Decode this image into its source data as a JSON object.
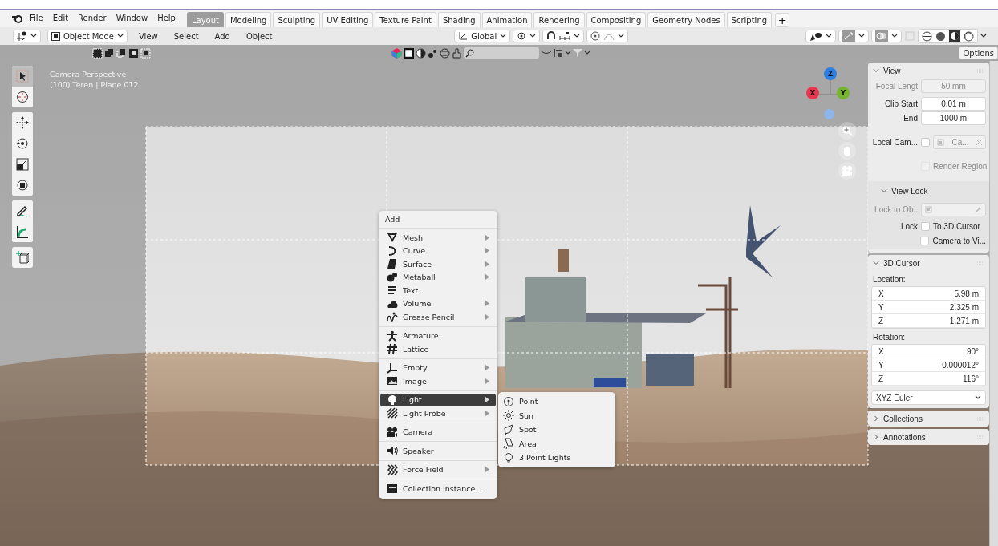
{
  "menubar": {
    "items": [
      "File",
      "Edit",
      "Render",
      "Window",
      "Help"
    ]
  },
  "workspaces": [
    {
      "label": "Layout",
      "selected": true
    },
    {
      "label": "Modeling",
      "selected": false
    },
    {
      "label": "Sculpting",
      "selected": false
    },
    {
      "label": "UV Editing",
      "selected": false
    },
    {
      "label": "Texture Paint",
      "selected": false
    },
    {
      "label": "Shading",
      "selected": false
    },
    {
      "label": "Animation",
      "selected": false
    },
    {
      "label": "Rendering",
      "selected": false
    },
    {
      "label": "Compositing",
      "selected": false
    },
    {
      "label": "Geometry Nodes",
      "selected": false
    },
    {
      "label": "Scripting",
      "selected": false
    }
  ],
  "add_workspace": "+",
  "header": {
    "mode": "Object Mode",
    "menus": [
      "View",
      "Select",
      "Add",
      "Object"
    ],
    "orientation": "Global"
  },
  "viewport": {
    "tool_options": "Options",
    "overlay_lines": [
      "Camera Perspective",
      "(100) Teren | Plane.012"
    ],
    "gizmo_axes": [
      {
        "label": "Z",
        "color": "#2f7fe0"
      },
      {
        "label": "X",
        "color": "#e8364f"
      },
      {
        "label": "Y",
        "color": "#78b52f"
      }
    ]
  },
  "add_menu": {
    "title": "Add",
    "groups": [
      [
        {
          "label": "Mesh",
          "kind": "mesh",
          "submenu": true,
          "selected": false
        },
        {
          "label": "Curve",
          "kind": "curve",
          "submenu": true,
          "selected": false
        },
        {
          "label": "Surface",
          "kind": "surface",
          "submenu": true,
          "selected": false
        },
        {
          "label": "Metaball",
          "kind": "metaball",
          "submenu": true,
          "selected": false
        },
        {
          "label": "Text",
          "kind": "text",
          "submenu": false,
          "selected": false
        },
        {
          "label": "Volume",
          "kind": "volume",
          "submenu": true,
          "selected": false
        },
        {
          "label": "Grease Pencil",
          "kind": "pencil",
          "submenu": true,
          "selected": false
        }
      ],
      [
        {
          "label": "Armature",
          "kind": "armature",
          "submenu": false,
          "selected": false
        },
        {
          "label": "Lattice",
          "kind": "lattice",
          "submenu": false,
          "selected": false
        }
      ],
      [
        {
          "label": "Empty",
          "kind": "empty",
          "submenu": true,
          "selected": false
        },
        {
          "label": "Image",
          "kind": "image",
          "submenu": true,
          "selected": false
        }
      ],
      [
        {
          "label": "Light",
          "kind": "light",
          "submenu": true,
          "selected": true
        },
        {
          "label": "Light Probe",
          "kind": "probe",
          "submenu": true,
          "selected": false
        }
      ],
      [
        {
          "label": "Camera",
          "kind": "camera",
          "submenu": false,
          "selected": false
        }
      ],
      [
        {
          "label": "Speaker",
          "kind": "speaker",
          "submenu": false,
          "selected": false
        }
      ],
      [
        {
          "label": "Force Field",
          "kind": "force",
          "submenu": true,
          "selected": false
        }
      ],
      [
        {
          "label": "Collection Instance...",
          "kind": "collection",
          "submenu": false,
          "selected": false
        }
      ]
    ]
  },
  "light_submenu": [
    {
      "label": "Point",
      "kind": "point"
    },
    {
      "label": "Sun",
      "kind": "sun"
    },
    {
      "label": "Spot",
      "kind": "spot"
    },
    {
      "label": "Area",
      "kind": "area"
    },
    {
      "label": "3 Point Lights",
      "kind": "bulb"
    }
  ],
  "sidebar": {
    "view": {
      "title": "View",
      "expanded": true,
      "fields": [
        {
          "label": "Focal Lengt",
          "value": "50 mm",
          "disabled": true
        },
        {
          "label": "Clip Start",
          "value": "0.01 m",
          "disabled": false
        },
        {
          "label": "End",
          "value": "1000 m",
          "disabled": false
        }
      ],
      "local_camera": {
        "label": "Local Cam...",
        "checked": false,
        "value": "Ca..."
      },
      "render_region": {
        "label": "Render Region",
        "checked": false,
        "disabled": true
      },
      "view_lock": {
        "title": "View Lock",
        "expanded": true,
        "lock_to_object": {
          "label": "Lock to Ob..",
          "disabled": true
        },
        "lock_label": "Lock",
        "options": [
          {
            "label": "To 3D Cursor",
            "checked": false
          },
          {
            "label": "Camera to Vi...",
            "checked": false
          }
        ]
      }
    },
    "cursor": {
      "title": "3D Cursor",
      "expanded": true,
      "location_label": "Location:",
      "location": [
        {
          "axis": "X",
          "value": "5.98 m"
        },
        {
          "axis": "Y",
          "value": "2.325 m"
        },
        {
          "axis": "Z",
          "value": "1.271 m"
        }
      ],
      "rotation_label": "Rotation:",
      "rotation": [
        {
          "axis": "X",
          "value": "90°"
        },
        {
          "axis": "Y",
          "value": "-0.000012°"
        },
        {
          "axis": "Z",
          "value": "116°"
        }
      ],
      "rotation_mode": "XYZ Euler"
    },
    "collapsed": [
      {
        "title": "Collections",
        "expanded": false
      },
      {
        "title": "Annotations",
        "expanded": false
      }
    ]
  }
}
